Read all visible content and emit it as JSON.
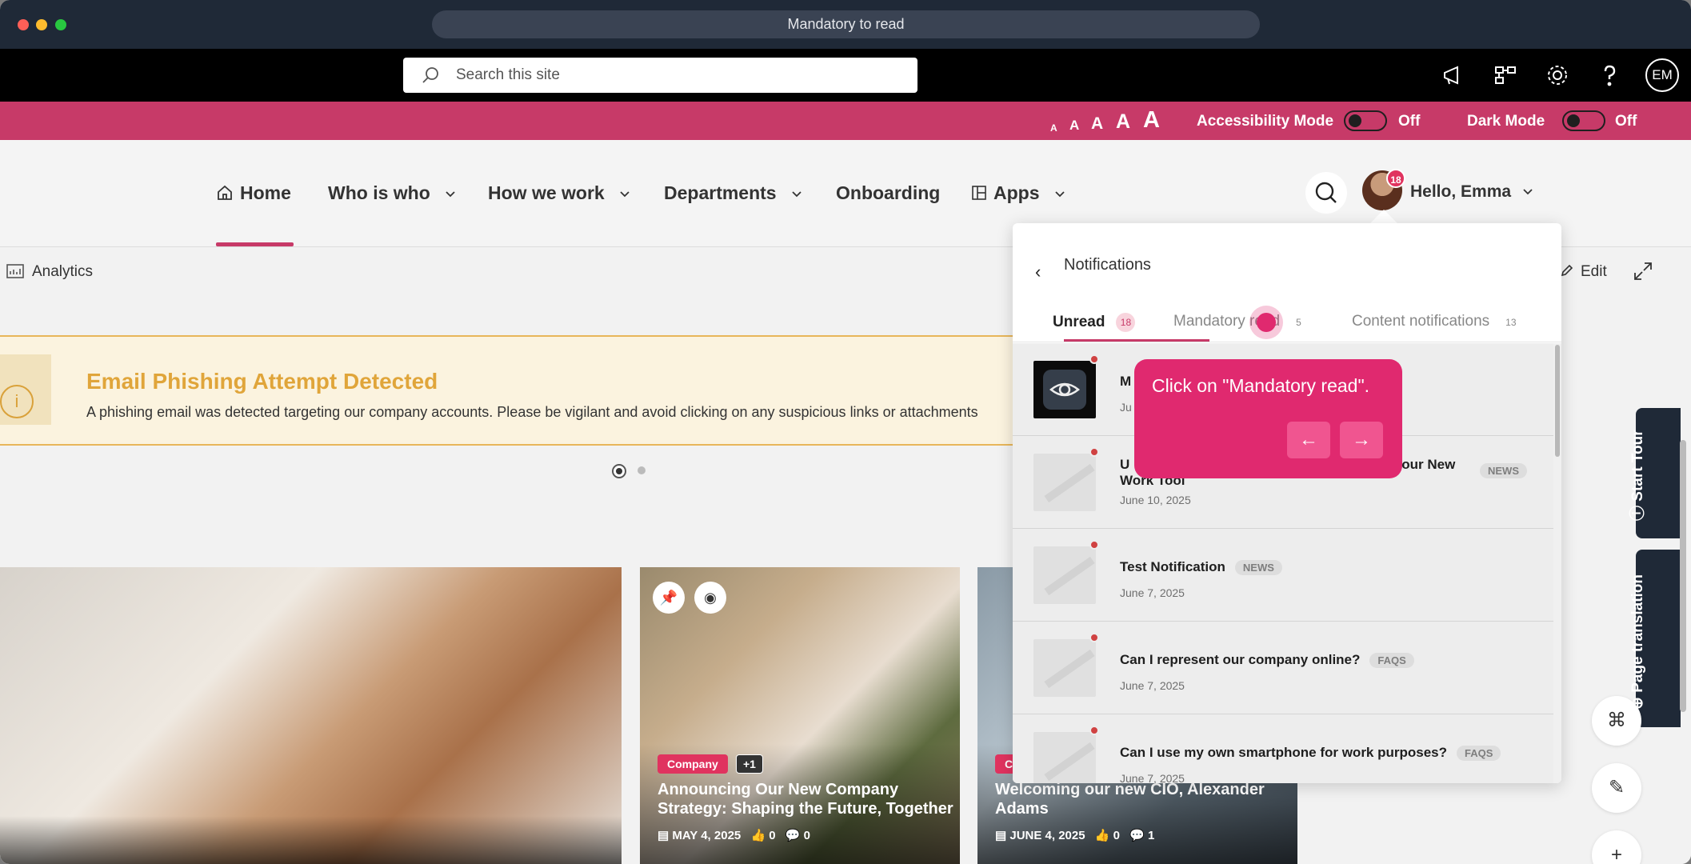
{
  "window": {
    "title": "Mandatory to read"
  },
  "suitebar": {
    "search_placeholder": "Search this site",
    "user_initials": "EM"
  },
  "accessibility": {
    "font_sizes": [
      "A",
      "A",
      "A",
      "A",
      "A"
    ],
    "accessibility_label": "Accessibility Mode",
    "accessibility_state": "Off",
    "dark_label": "Dark Mode",
    "dark_state": "Off"
  },
  "nav": {
    "items": [
      {
        "label": "Home"
      },
      {
        "label": "Who is who"
      },
      {
        "label": "How we work"
      },
      {
        "label": "Departments"
      },
      {
        "label": "Onboarding"
      },
      {
        "label": "Apps"
      }
    ],
    "notification_count": "18",
    "greeting": "Hello, Emma"
  },
  "commandbar": {
    "analytics": "Analytics",
    "edit": "Edit"
  },
  "alert": {
    "title": "Email Phishing Attempt Detected",
    "text": "A phishing email was detected targeting our company accounts. Please be vigilant and avoid clicking on any suspicious links or attachments"
  },
  "cards": [
    {},
    {
      "tag": "Company",
      "extra": "+1",
      "title": "Announcing Our New Company Strategy: Shaping the Future, Together",
      "date": "MAY 4, 2025",
      "likes": "0",
      "comments": "0"
    },
    {
      "tag": "C",
      "title": "Welcoming our new CIO, Alexander Adams",
      "date": "JUNE 4, 2025",
      "likes": "0",
      "comments": "1"
    }
  ],
  "notifications": {
    "title": "Notifications",
    "tabs": [
      {
        "label": "Unread",
        "count": "18"
      },
      {
        "label": "Mandatory read",
        "count": "5"
      },
      {
        "label": "Content notifications",
        "count": "13"
      }
    ],
    "items": [
      {
        "title": "M",
        "badge": "",
        "date": "Ju"
      },
      {
        "title": "U",
        "title_end": "our New",
        "title_line2": "Work Tool",
        "badge": "NEWS",
        "date": "June 10, 2025"
      },
      {
        "title": "Test Notification",
        "badge": "NEWS",
        "date": "June 7, 2025"
      },
      {
        "title": "Can I represent our company online?",
        "badge": "FAQS",
        "date": "June 7, 2025"
      },
      {
        "title": "Can I use my own smartphone for work purposes?",
        "badge": "FAQS",
        "date": "June 7, 2025"
      }
    ]
  },
  "tour": {
    "text": "Click on \"Mandatory read\".",
    "prev": "←",
    "next": "→"
  },
  "side": {
    "start_tour": "Start Tour",
    "page_translation": "Page translation"
  }
}
